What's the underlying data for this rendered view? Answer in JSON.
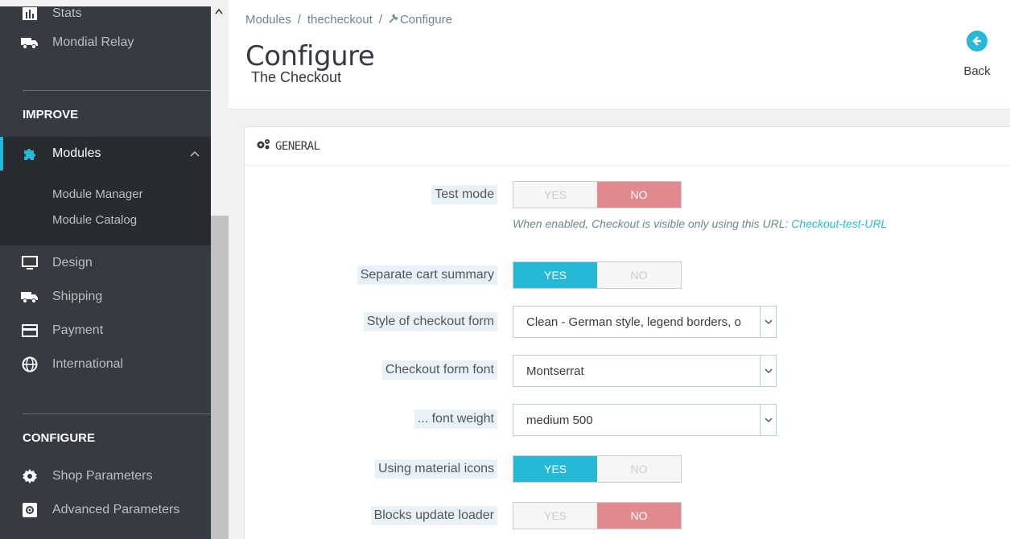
{
  "sidebar": {
    "items_top": [
      {
        "label": "Stats",
        "icon": "stats-icon"
      },
      {
        "label": "Mondial Relay",
        "icon": "truck-icon"
      }
    ],
    "section_improve": "IMPROVE",
    "modules": {
      "label": "Modules",
      "icon": "puzzle-icon",
      "subitems": [
        "Module Manager",
        "Module Catalog"
      ]
    },
    "items_mid": [
      {
        "label": "Design",
        "icon": "monitor-icon"
      },
      {
        "label": "Shipping",
        "icon": "truck-icon"
      },
      {
        "label": "Payment",
        "icon": "credit-card-icon"
      },
      {
        "label": "International",
        "icon": "globe-icon"
      }
    ],
    "section_configure": "CONFIGURE",
    "items_bottom": [
      {
        "label": "Shop Parameters",
        "icon": "gear-icon"
      },
      {
        "label": "Advanced Parameters",
        "icon": "advanced-gear-icon"
      }
    ]
  },
  "header": {
    "breadcrumb": [
      "Modules",
      "thecheckout",
      "Configure"
    ],
    "title": "Configure",
    "subtitle": "The Checkout",
    "back_label": "Back"
  },
  "panel": {
    "title": "GENERAL",
    "help_text": "When enabled, Checkout is visible only using this URL:",
    "help_link": "Checkout-test-URL",
    "toggle_yes": "YES",
    "toggle_no": "NO",
    "fields": {
      "test_mode": {
        "label": "Test mode",
        "value": "NO"
      },
      "separate_cart": {
        "label": "Separate cart summary",
        "value": "YES"
      },
      "style": {
        "label": "Style of checkout form",
        "value": "Clean - German style, legend borders, o"
      },
      "font": {
        "label": "Checkout form font",
        "value": "Montserrat"
      },
      "weight": {
        "label": "... font weight",
        "value": "medium 500"
      },
      "material_icons": {
        "label": "Using material icons",
        "value": "YES"
      },
      "loader": {
        "label": "Blocks update loader",
        "value": "NO"
      }
    }
  },
  "colors": {
    "accent": "#25b9d7",
    "no_active": "#e08a8f",
    "sidebar": "#363a41"
  }
}
